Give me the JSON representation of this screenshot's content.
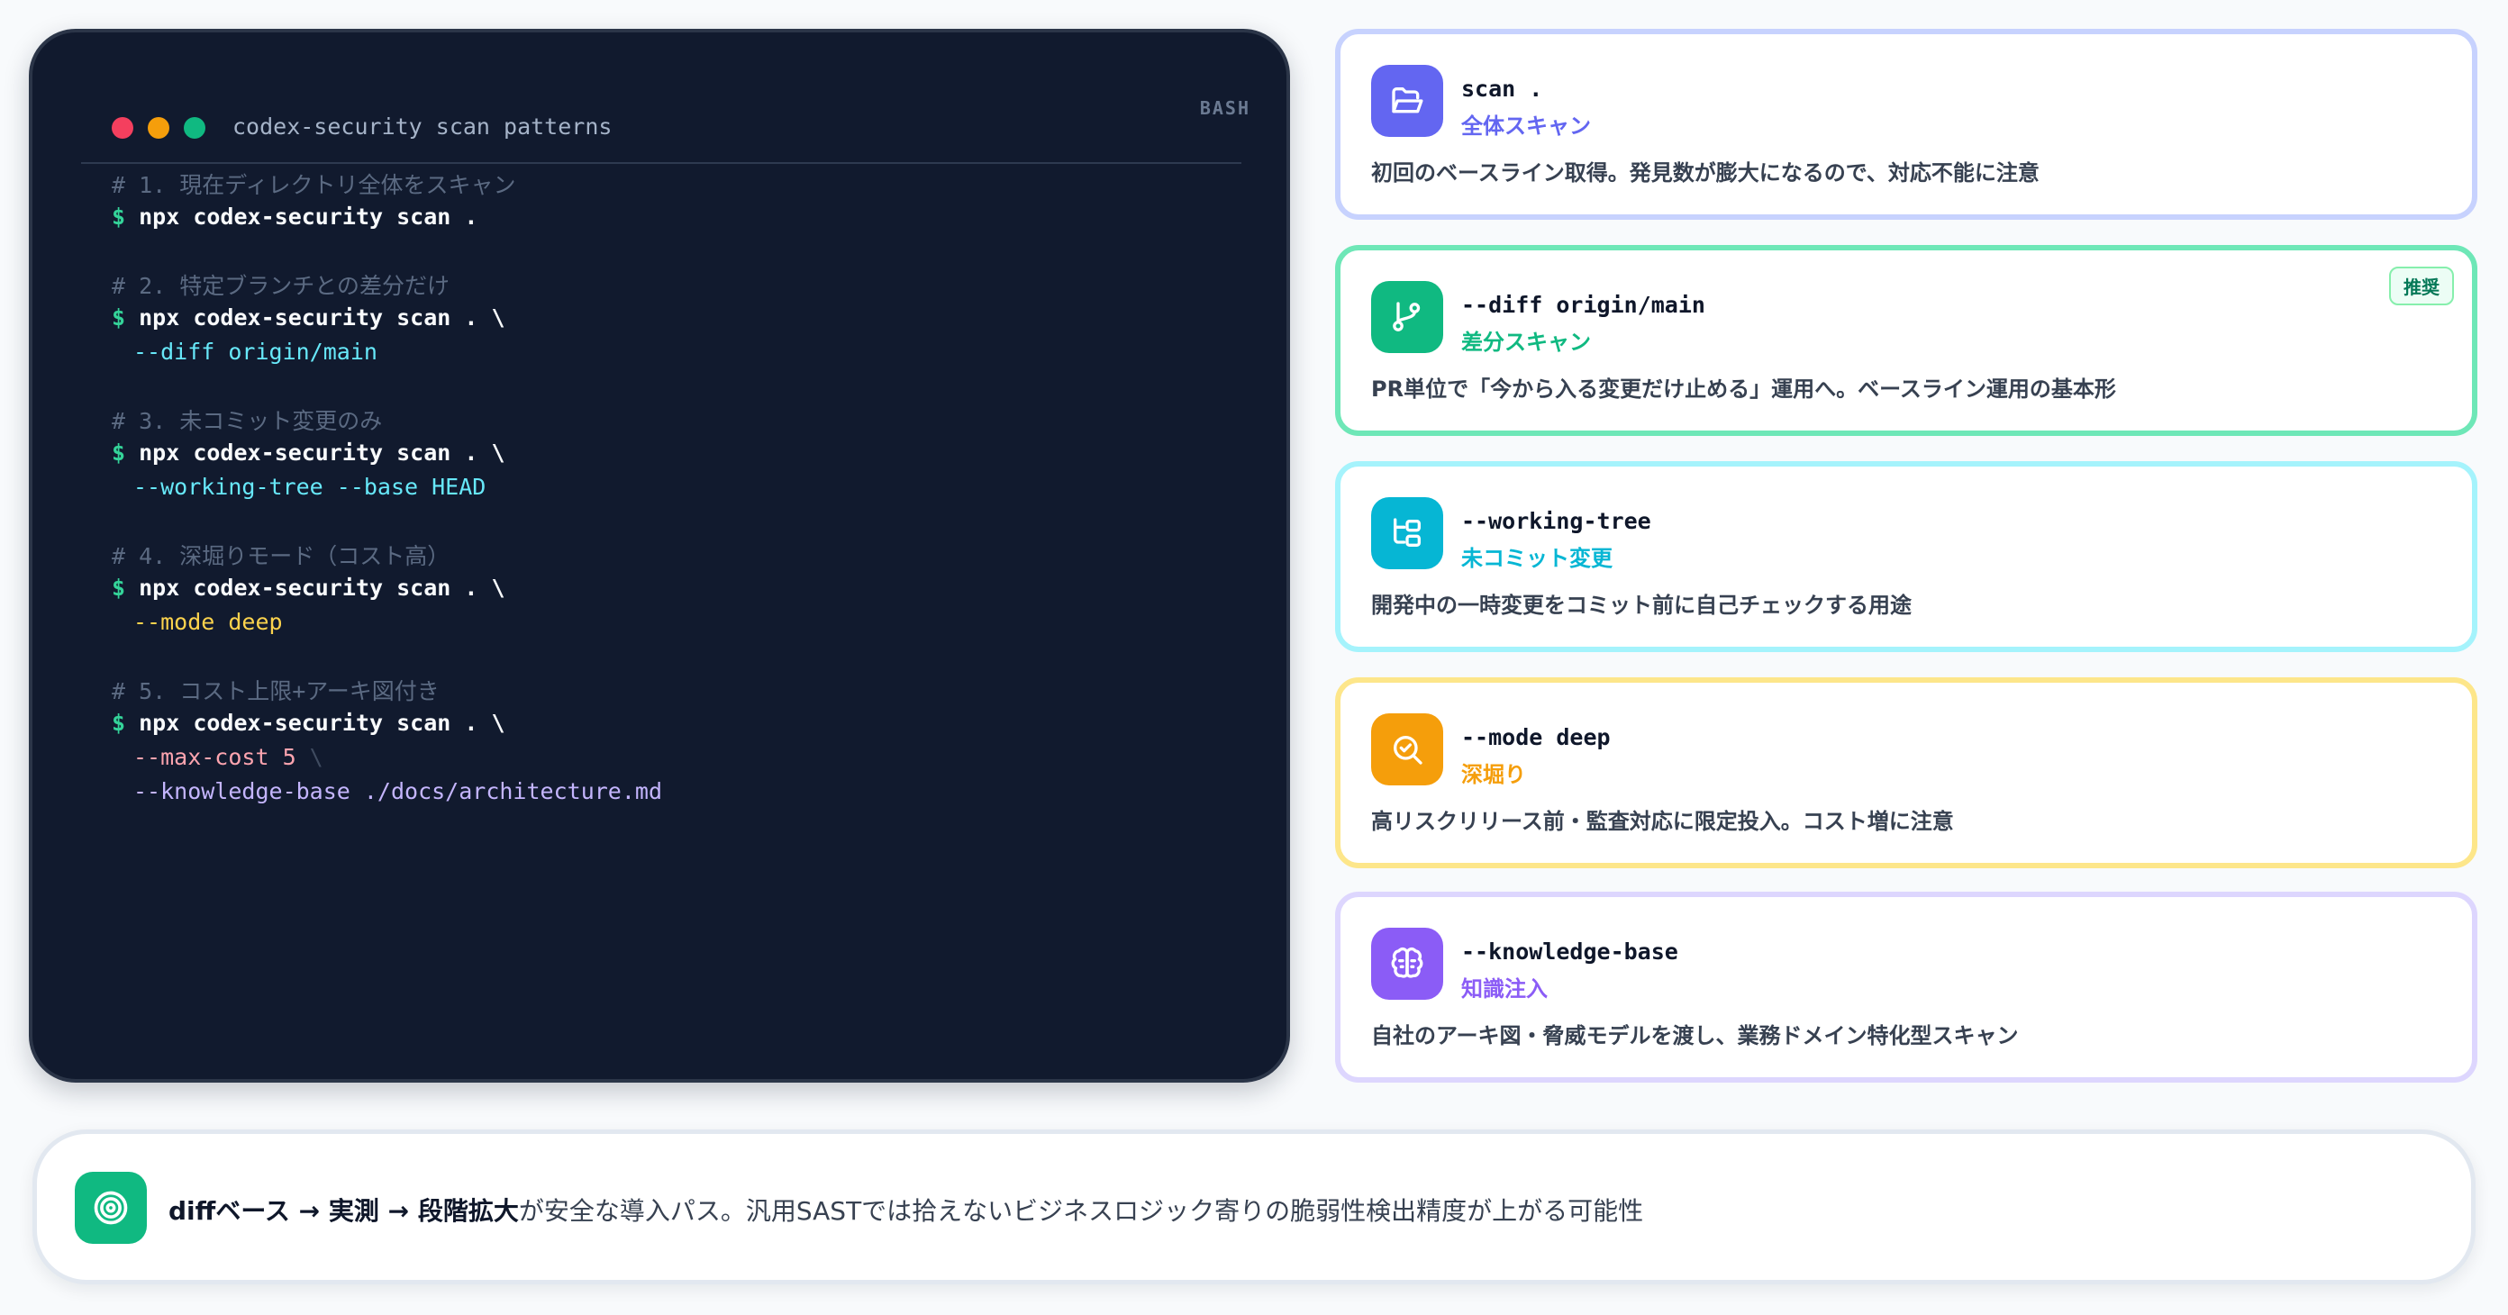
{
  "terminal": {
    "title": "codex-security scan patterns",
    "language": "BASH",
    "prompt": "$",
    "lines": [
      {
        "comment": "# 1. 現在ディレクトリ全体をスキャン",
        "command": "npx codex-security scan ."
      },
      {
        "comment": "# 2. 特定ブランチとの差分だけ",
        "command": "npx codex-security scan . \\",
        "continuation": "--diff origin/main"
      },
      {
        "comment": "# 3. 未コミット変更のみ",
        "command": "npx codex-security scan . \\",
        "continuation": "--working-tree --base HEAD"
      },
      {
        "comment": "# 4. 深堀りモード（コスト高）",
        "command": "npx codex-security scan . \\",
        "continuation": "--mode deep"
      },
      {
        "comment": "# 5. コスト上限+アーキ図付き",
        "command": "npx codex-security scan . \\",
        "continuation_1": "--max-cost 5",
        "continuation_1_tail": " \\",
        "continuation_2": "--knowledge-base ./docs/architecture.md"
      }
    ]
  },
  "cards": [
    {
      "flag": "scan .",
      "subtitle": "全体スキャン",
      "description": "初回のベースライン取得。発見数が膨大になるので、対応不能に注意",
      "icon": "folder-open-icon",
      "color": "#6366f1",
      "border": "#c7d2fe"
    },
    {
      "flag": "--diff origin/main",
      "subtitle": "差分スキャン",
      "description": "PR単位で「今から入る変更だけ止める」運用へ。ベースライン運用の基本形",
      "icon": "git-branch-icon",
      "badge": "推奨",
      "color": "#10b981",
      "border": "#6ee7b7"
    },
    {
      "flag": "--working-tree",
      "subtitle": "未コミット変更",
      "description": "開発中の一時変更をコミット前に自己チェックする用途",
      "icon": "folder-tree-icon",
      "color": "#06b6d4",
      "border": "#a5f3fc"
    },
    {
      "flag": "--mode deep",
      "subtitle": "深堀り",
      "description": "高リスクリリース前・監査対応に限定投入。コスト増に注意",
      "icon": "search-check-icon",
      "color": "#f59e0b",
      "border": "#fde68a"
    },
    {
      "flag": "--knowledge-base",
      "subtitle": "知識注入",
      "description": "自社のアーキ図・脅威モデルを渡し、業務ドメイン特化型スキャン",
      "icon": "brain-icon",
      "color": "#8b5cf6",
      "border": "#ddd6fe"
    }
  ],
  "summary": {
    "icon": "target-icon",
    "emphasis": "diffベース → 実測 → 段階拡大",
    "text": "が安全な導入パス。汎用SASTでは拾えないビジネスロジック寄りの脆弱性検出精度が上がる可能性"
  }
}
